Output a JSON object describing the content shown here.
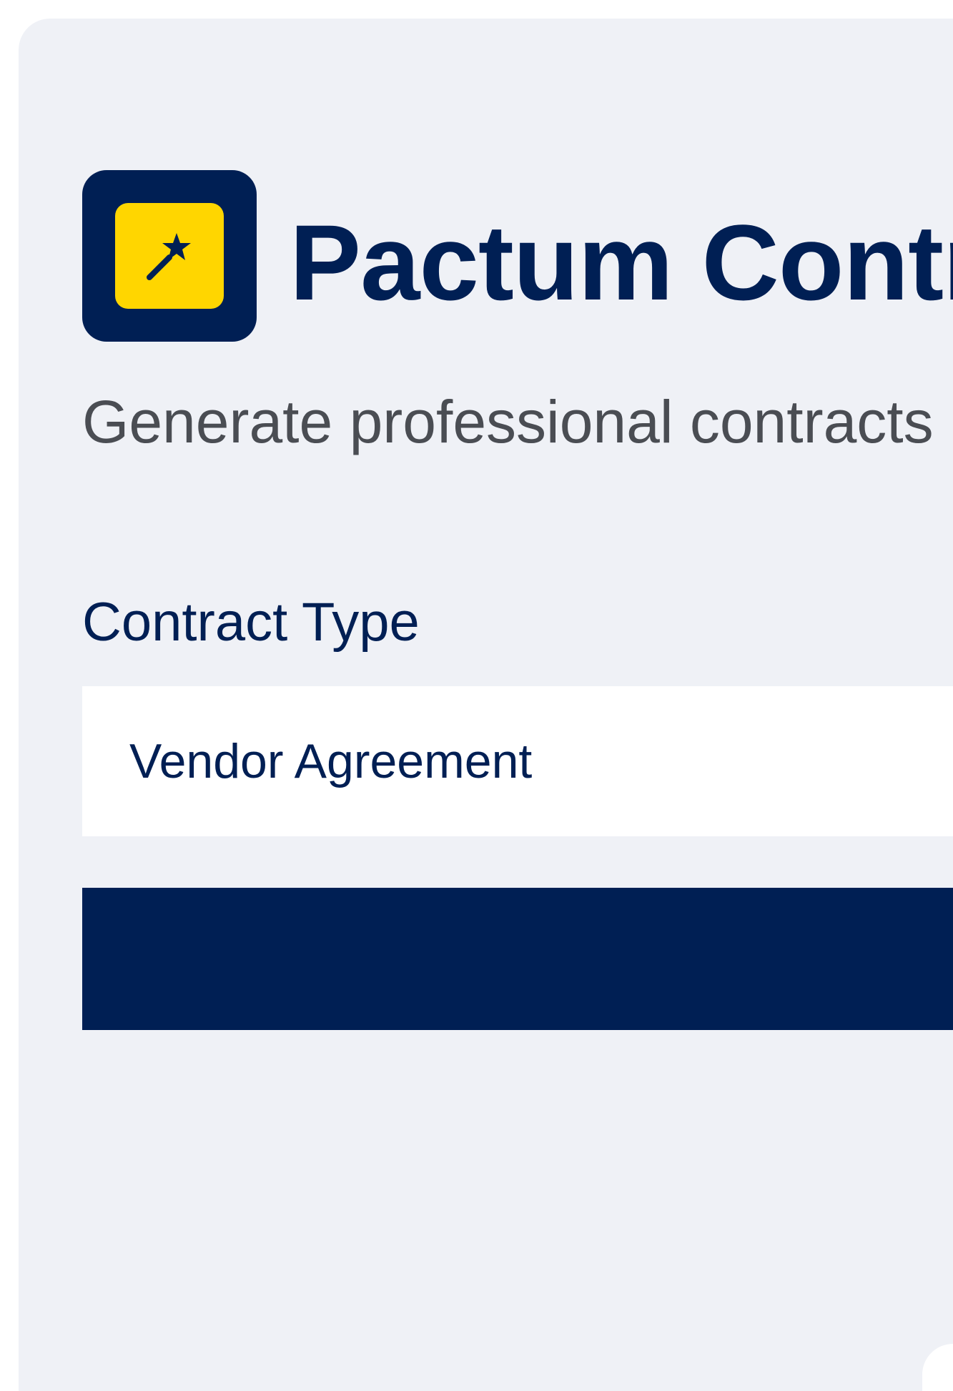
{
  "app": {
    "title": "Pactum Contra",
    "subtitle": "Generate professional contracts",
    "logo_icon": "magic-wand-icon"
  },
  "form": {
    "contract_type_label": "Contract Type",
    "contract_type_value": "Vendor Agreement",
    "submit_label": ""
  },
  "colors": {
    "navy": "#001f54",
    "yellow": "#ffd600",
    "background": "#eff1f6",
    "subtitle_gray": "#4a4d53"
  }
}
